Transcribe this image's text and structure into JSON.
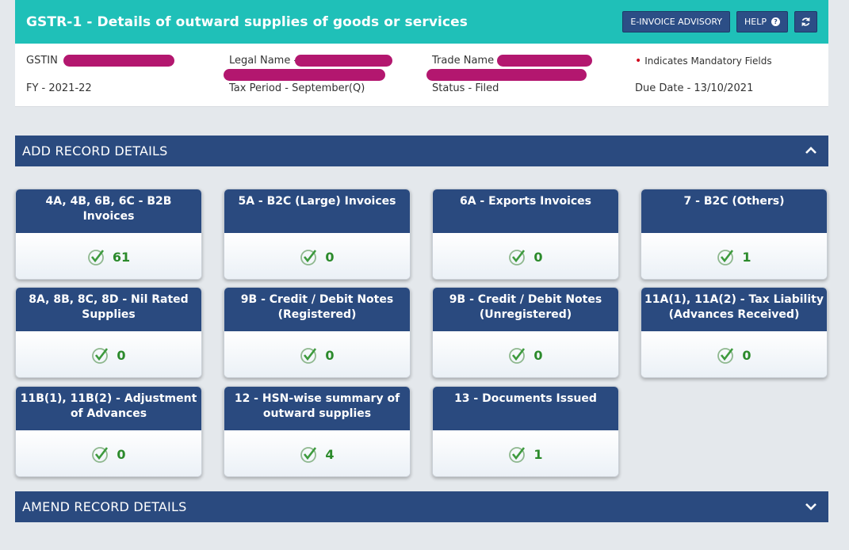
{
  "header": {
    "title": "GSTR-1 - Details of outward supplies of goods or services",
    "einvoice_label": "E-INVOICE ADVISORY",
    "help_label": "HELP"
  },
  "info": {
    "gstin_label": "GSTIN",
    "legal_name_label": "Legal Name -",
    "trade_name_label": "Trade Name",
    "mandatory_note": "Indicates Mandatory Fields",
    "fy": "FY - 2021-22",
    "tax_period": "Tax Period - September(Q)",
    "status": "Status - Filed",
    "due_date": "Due Date - 13/10/2021"
  },
  "sections": {
    "add": "ADD RECORD DETAILS",
    "amend": "AMEND RECORD DETAILS"
  },
  "tiles": [
    {
      "title": "4A, 4B, 6B, 6C - B2B Invoices",
      "count": "61"
    },
    {
      "title": "5A - B2C (Large) Invoices",
      "count": "0"
    },
    {
      "title": "6A - Exports Invoices",
      "count": "0"
    },
    {
      "title": "7 - B2C (Others)",
      "count": "1"
    },
    {
      "title": "8A, 8B, 8C, 8D - Nil Rated Supplies",
      "count": "0"
    },
    {
      "title": "9B - Credit / Debit Notes (Registered)",
      "count": "0"
    },
    {
      "title": "9B - Credit / Debit Notes (Unregistered)",
      "count": "0"
    },
    {
      "title": "11A(1), 11A(2) - Tax Liability (Advances Received)",
      "count": "0"
    },
    {
      "title": "11B(1), 11B(2) - Adjustment of Advances",
      "count": "0"
    },
    {
      "title": "12 - HSN-wise summary of outward supplies",
      "count": "4"
    },
    {
      "title": "13 - Documents Issued",
      "count": "1"
    }
  ],
  "colors": {
    "header_teal": "#1fc0b8",
    "navy": "#2a4a7f",
    "count_green": "#2b8a2b",
    "redaction": "#b3176f"
  }
}
